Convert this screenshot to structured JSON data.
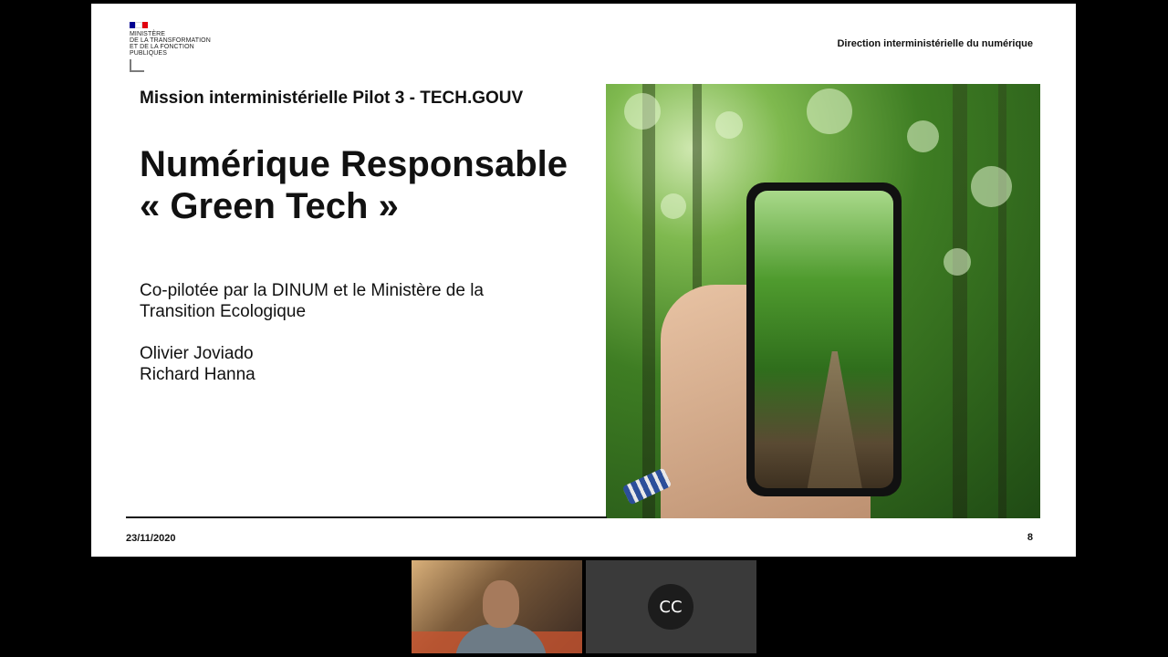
{
  "slide": {
    "logo_lines": [
      "MINISTÈRE",
      "DE LA TRANSFORMATION",
      "ET DE LA FONCTION",
      "PUBLIQUES"
    ],
    "header_right": "Direction interministérielle du numérique",
    "subtitle": "Mission interministérielle Pilot 3 - TECH.GOUV",
    "title_line1": "Numérique Responsable",
    "title_line2": "« Green Tech »",
    "desc_line1": "Co-pilotée par la DINUM et le Ministère de la",
    "desc_line2": "Transition Ecologique",
    "author1": "Olivier Joviado",
    "author2": "Richard Hanna",
    "date": "23/11/2020",
    "page_number": "8",
    "colors": {
      "flag_blue": "#000091",
      "flag_white": "#ffffff",
      "flag_red": "#e1000f"
    }
  },
  "participants": [
    {
      "type": "video",
      "icon": "webcam-feed"
    },
    {
      "type": "avatar",
      "initials": "CC"
    }
  ]
}
